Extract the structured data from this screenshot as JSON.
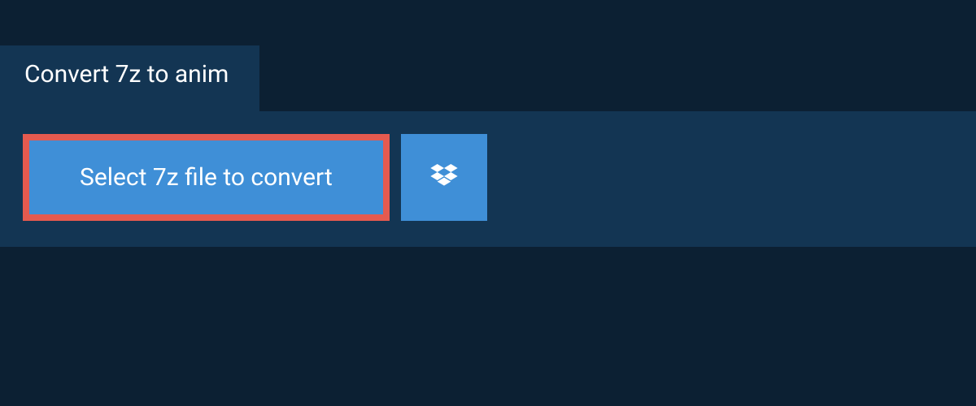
{
  "header": {
    "title": "Convert 7z to anim"
  },
  "upload": {
    "select_label": "Select 7z file to convert"
  }
}
